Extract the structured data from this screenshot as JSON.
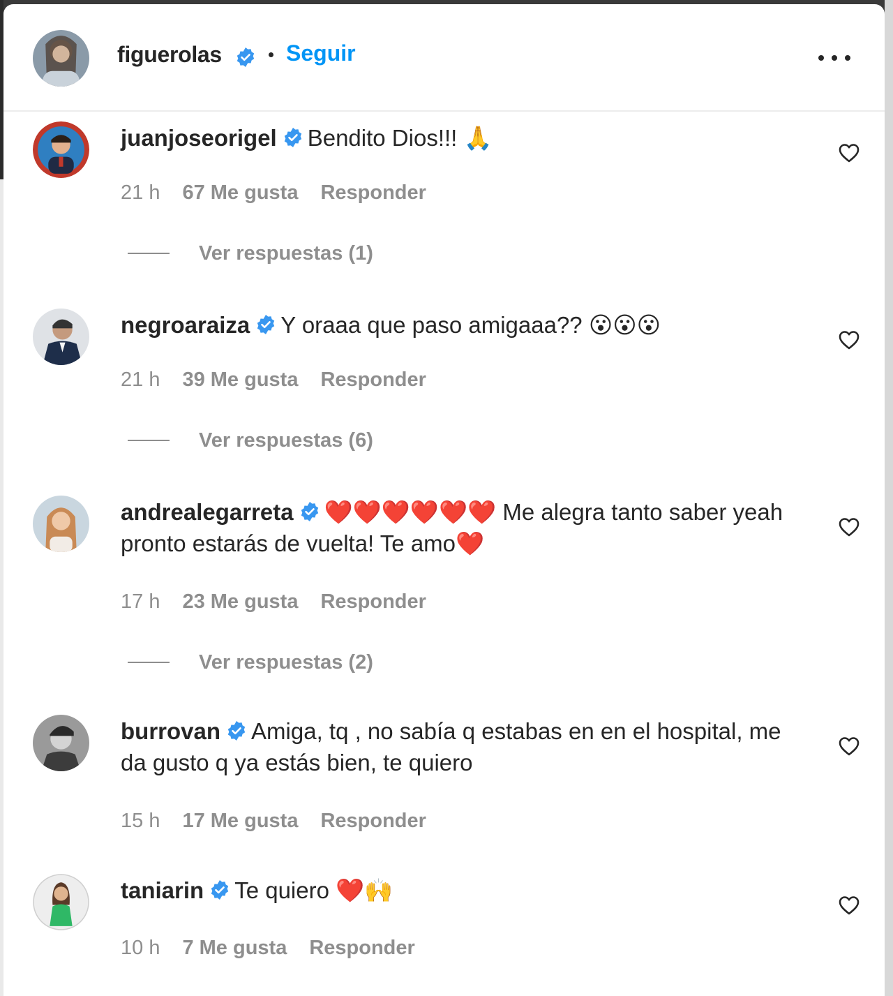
{
  "header": {
    "username": "figuerolas",
    "follow_label": "Seguir",
    "separator": "•"
  },
  "comments": [
    {
      "username": "juanjoseorigel",
      "text": "Bendito Dios!!! 🙏",
      "time": "21 h",
      "likes": "67 Me gusta",
      "reply": "Responder",
      "view_replies": "Ver respuestas (1)"
    },
    {
      "username": "negroaraiza",
      "text": "Y oraaa que paso amigaaa?? 😮😮😮",
      "time": "21 h",
      "likes": "39 Me gusta",
      "reply": "Responder",
      "view_replies": "Ver respuestas (6)"
    },
    {
      "username": "andrealegarreta",
      "text": "❤️❤️❤️❤️❤️❤️ Me alegra tanto saber yeah pronto estarás de vuelta! Te amo❤️",
      "time": "17 h",
      "likes": "23 Me gusta",
      "reply": "Responder",
      "view_replies": "Ver respuestas (2)"
    },
    {
      "username": "burrovan",
      "text": "Amiga, tq , no sabía q estabas en en el hospital, me da gusto q ya estás bien, te quiero",
      "time": "15 h",
      "likes": "17 Me gusta",
      "reply": "Responder"
    },
    {
      "username": "taniarin",
      "text": "Te quiero ❤️🙌",
      "time": "10 h",
      "likes": "7 Me gusta",
      "reply": "Responder"
    }
  ],
  "colors": {
    "accent": "#0095f6",
    "verified": "#3897f0",
    "text": "#262626",
    "muted": "#8e8e8e"
  },
  "icons": {
    "verified": "verified-badge-icon",
    "heart": "heart-outline-icon",
    "more": "more-horizontal-icon"
  }
}
